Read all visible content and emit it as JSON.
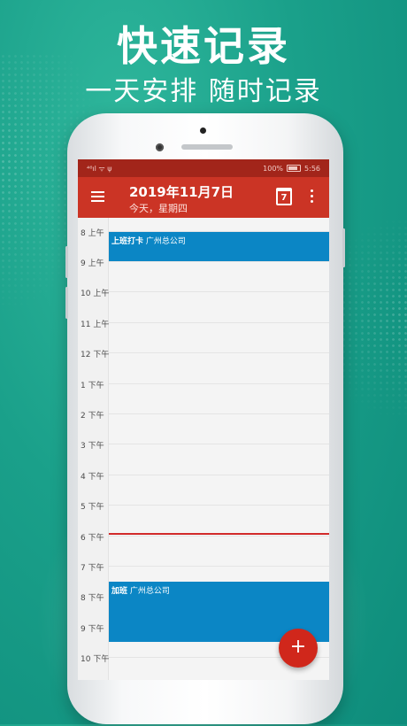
{
  "headline": {
    "title": "快速记录",
    "tagline": "一天安排  随时记录"
  },
  "status_bar": {
    "signal": "⁴⁶ıl ᯤ ψ",
    "battery_pct": "100%",
    "time": "5:56"
  },
  "app_bar": {
    "title": "2019年11月7日",
    "subtitle": "今天，星期四",
    "calendar_day": "7"
  },
  "timeline": {
    "hours": [
      "8 上午",
      "9 上午",
      "10 上午",
      "11 上午",
      "12 下午",
      "1 下午",
      "2 下午",
      "3 下午",
      "4 下午",
      "5 下午",
      "6 下午",
      "7 下午",
      "8 下午",
      "9 下午",
      "10 下午"
    ]
  },
  "events": [
    {
      "title": "上班打卡",
      "location": "广州总公司"
    },
    {
      "title": "加班",
      "location": "广州总公司"
    }
  ],
  "fab": {
    "label": "+"
  },
  "colors": {
    "app_bar": "#cb3425",
    "status_bar": "#a2251a",
    "event": "#0b86c5",
    "now_line": "#d12a2a",
    "fab": "#d0271b"
  }
}
